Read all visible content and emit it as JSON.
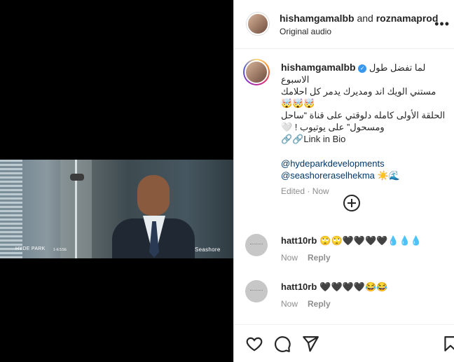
{
  "video": {
    "watermark_left": "HYDE PARK",
    "watermark_mid": "1-ESSE",
    "watermark_right": "Seashore"
  },
  "header": {
    "user1": "hishamgamalbb",
    "and": " and ",
    "user2": "roznamaprod",
    "subtitle": "Original audio",
    "more": "•••"
  },
  "caption": {
    "username": "hishamgamalbb",
    "verified": "✓",
    "line1": "لما تفضل طول الاسبوع",
    "line2": "مستني الويك اند ومديرك يدمر كل احلامك 🤯🤯🤯",
    "line3": "الحلقة الأولى كامله دلوقتي على قناة “ساحل",
    "line4": "ومسحول” على يوتيوب ! 🤍",
    "line5": "🔗🔗Link in Bio",
    "mention1": "@hydeparkdevelopments",
    "mention2": "@seashoreraselhekma",
    "mention2_suffix": " ☀️🌊",
    "edited": "Edited",
    "time": "Now"
  },
  "comments": [
    {
      "user": "hatt10rb",
      "text": "🙄🙄🖤🖤🖤🖤💧💧💧",
      "time": "Now",
      "reply": "Reply"
    },
    {
      "user": "hatt10rb",
      "text": "🖤🖤🖤🖤😂😂",
      "time": "Now",
      "reply": "Reply"
    }
  ]
}
